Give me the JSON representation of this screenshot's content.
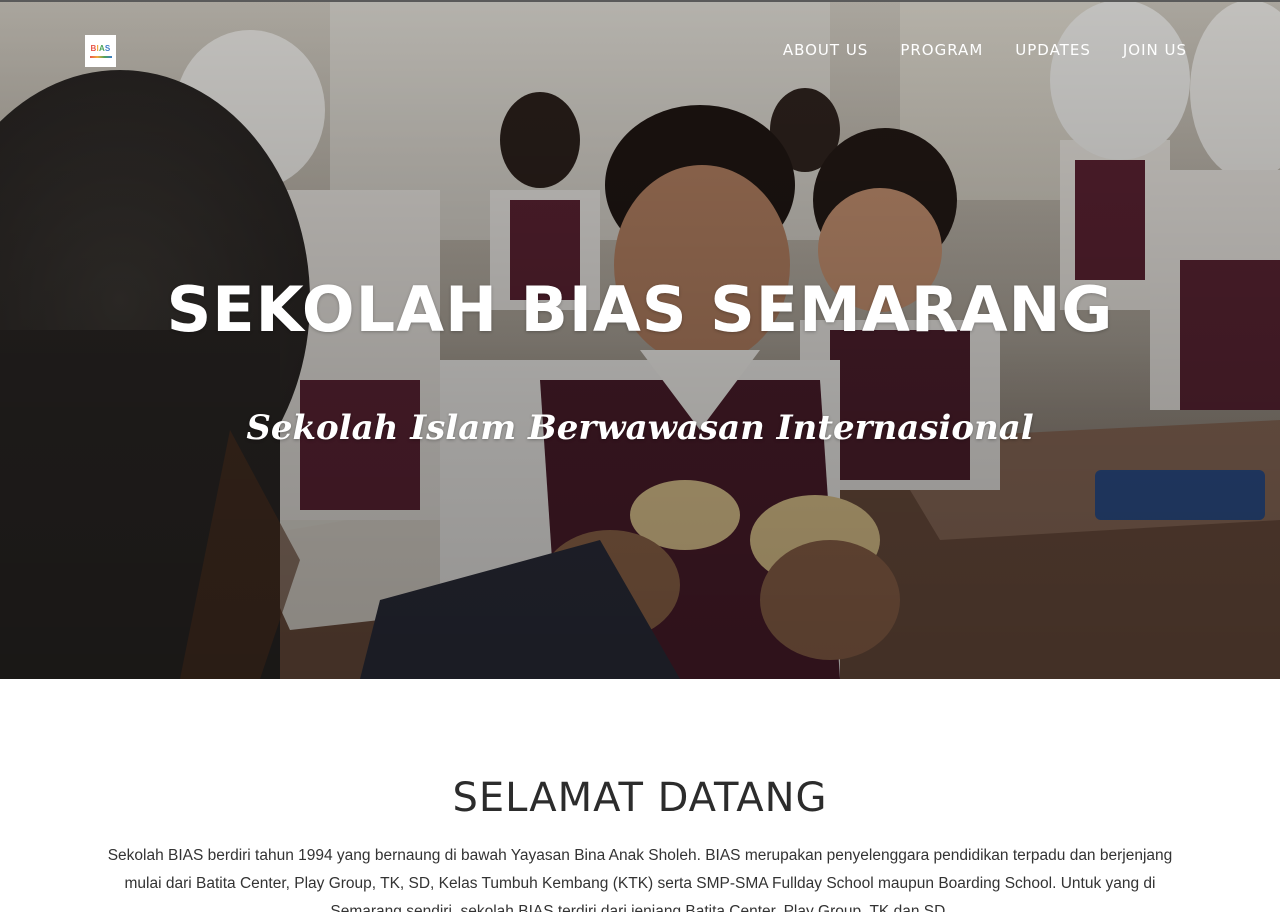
{
  "nav": {
    "logo_text": "BIAS",
    "links": [
      "ABOUT US",
      "PROGRAM",
      "UPDATES",
      "JOIN US"
    ]
  },
  "hero": {
    "title": "SEKOLAH BIAS SEMARANG",
    "subtitle": "Sekolah Islam Berwawasan Internasional"
  },
  "welcome": {
    "title": "SELAMAT DATANG",
    "text": "Sekolah BIAS berdiri tahun 1994 yang bernaung di bawah Yayasan Bina Anak Sholeh. BIAS merupakan penyelenggara pendidikan terpadu dan berjenjang mulai dari Batita Center, Play Group, TK, SD, Kelas Tumbuh Kembang (KTK) serta SMP-SMA Fullday School maupun Boarding School. Untuk yang di Semarang sendiri, sekolah BIAS terdiri dari jenjang Batita Center, Play Group, TK dan SD."
  },
  "colors": {
    "nav_text": "#ffffff",
    "heading_text": "#2c2c2c",
    "body_text": "#333333",
    "logo_red": "#e8574a",
    "logo_orange": "#f2a93b",
    "logo_green": "#4aa35a",
    "logo_blue": "#3d7cc9"
  }
}
